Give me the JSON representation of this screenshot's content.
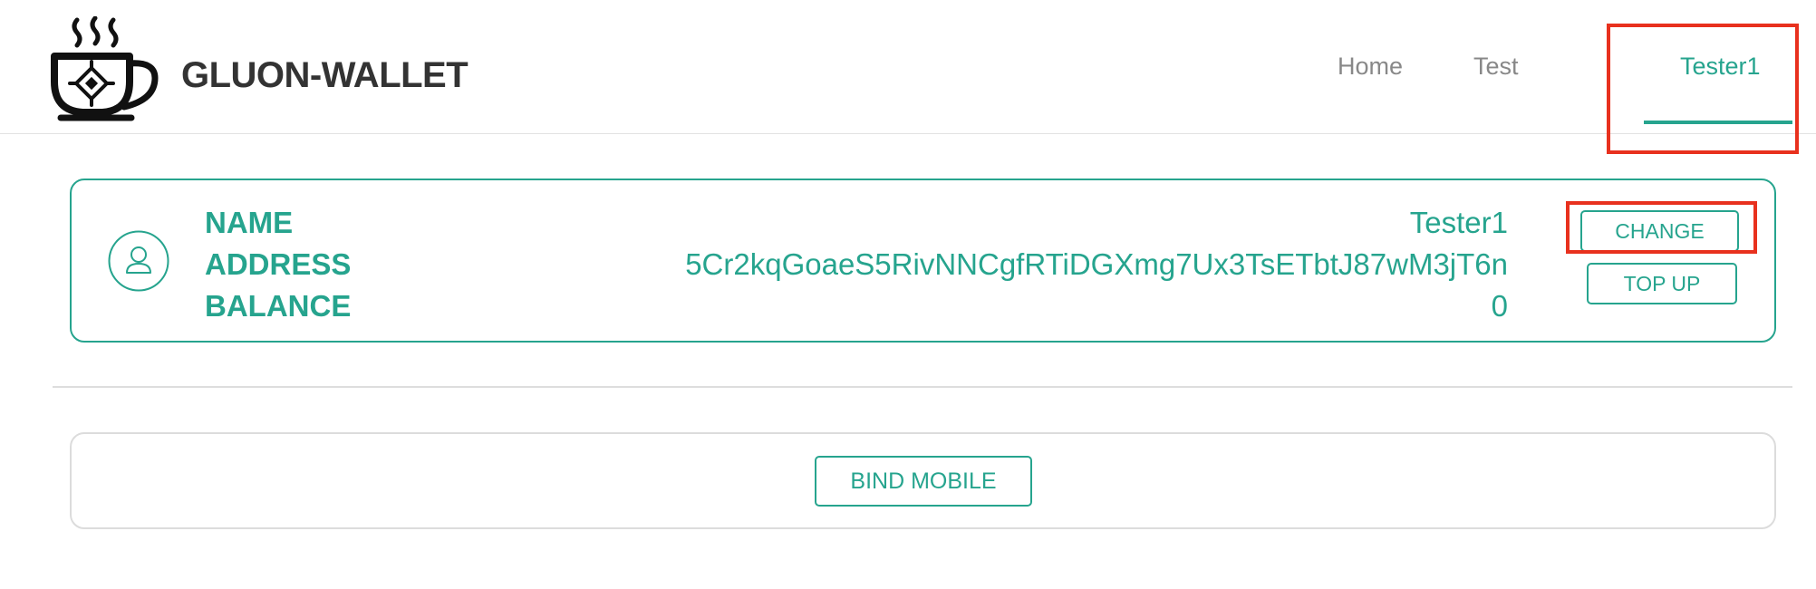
{
  "header": {
    "brand_name": "GLUON-WALLET",
    "logo_icon": "coffee-cup-chip-icon",
    "nav": {
      "home": "Home",
      "test": "Test",
      "user": "Tester1"
    },
    "active_nav": "user"
  },
  "profile": {
    "avatar_icon": "user-icon",
    "labels": {
      "name": "NAME",
      "address": "ADDRESS",
      "balance": "BALANCE"
    },
    "values": {
      "name": "Tester1",
      "address": "5Cr2kqGoaeS5RivNNCgfRTiDGXmg7Ux3TsETbtJ87wM3jT6n",
      "balance": "0"
    },
    "buttons": {
      "change": "CHANGE",
      "top_up": "TOP UP"
    }
  },
  "bind": {
    "button_label": "BIND MOBILE"
  },
  "colors": {
    "accent": "#26a48e",
    "highlight": "#e8311e",
    "brand_text": "#333333",
    "nav_text": "#888888"
  }
}
